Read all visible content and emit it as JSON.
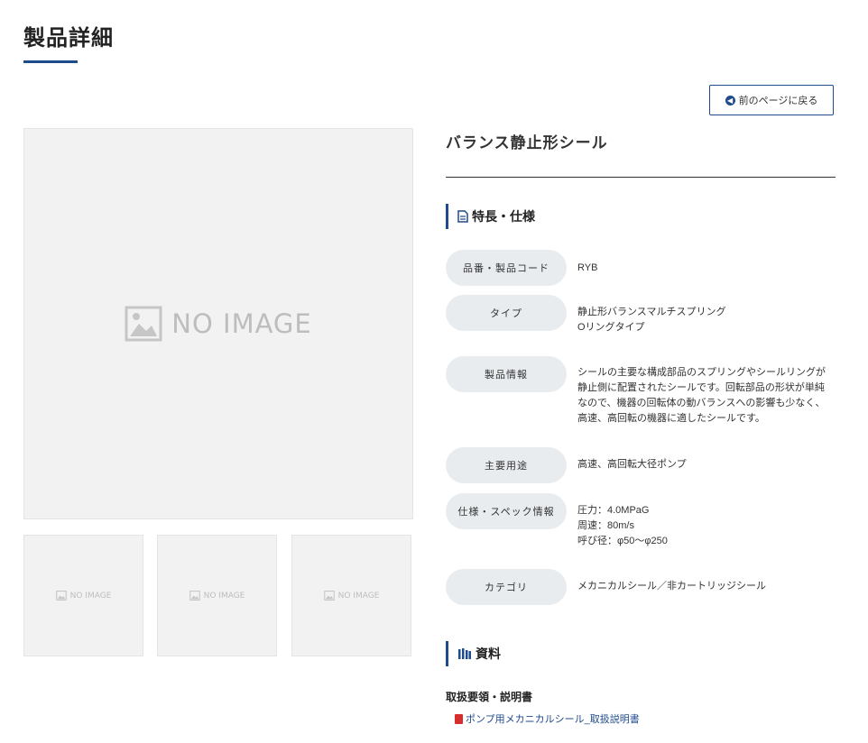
{
  "page": {
    "title": "製品詳細"
  },
  "back_button": {
    "label": "前のページに戻る",
    "icon": "arrow-left-circle-icon"
  },
  "gallery": {
    "main": {
      "placeholder": "NO IMAGE"
    },
    "thumbnails": [
      {
        "placeholder": "NO IMAGE"
      },
      {
        "placeholder": "NO IMAGE"
      },
      {
        "placeholder": "NO IMAGE"
      }
    ]
  },
  "product": {
    "name": "バランス静止形シール"
  },
  "features": {
    "heading": "特長・仕様",
    "rows": [
      {
        "label": "品番・製品コード",
        "lines": [
          "RYB"
        ]
      },
      {
        "label": "タイプ",
        "lines": [
          "静止形バランスマルチスプリング",
          "Oリングタイプ"
        ]
      },
      {
        "label": "製品情報",
        "lines": [
          "シールの主要な構成部品のスプリングやシールリングが",
          "静止側に配置されたシールです。回転部品の形状が単純",
          "なので、機器の回転体の動バランスへの影響も少なく、",
          "高速、高回転の機器に適したシールです。"
        ]
      },
      {
        "label": "主要用途",
        "lines": [
          "高速、高回転大径ポンプ"
        ]
      },
      {
        "label": "仕様・スペック情報",
        "lines": [
          "圧力：4.0MPaG",
          "周速：80m/s",
          "呼び径：φ50〜φ250"
        ]
      },
      {
        "label": "カテゴリ",
        "lines": [
          "メカニカルシール／非カートリッジシール"
        ]
      }
    ]
  },
  "documents": {
    "heading": "資料",
    "subtitle": "取扱要領・説明書",
    "links": [
      {
        "label": "ポンプ用メカニカルシール_取扱説明書",
        "icon": "pdf-icon"
      }
    ]
  },
  "colors": {
    "accent": "#1f4a8c",
    "pdf": "#d62d2d",
    "pill": "#e9ecef",
    "placeholder_bg": "#f2f2f2"
  }
}
